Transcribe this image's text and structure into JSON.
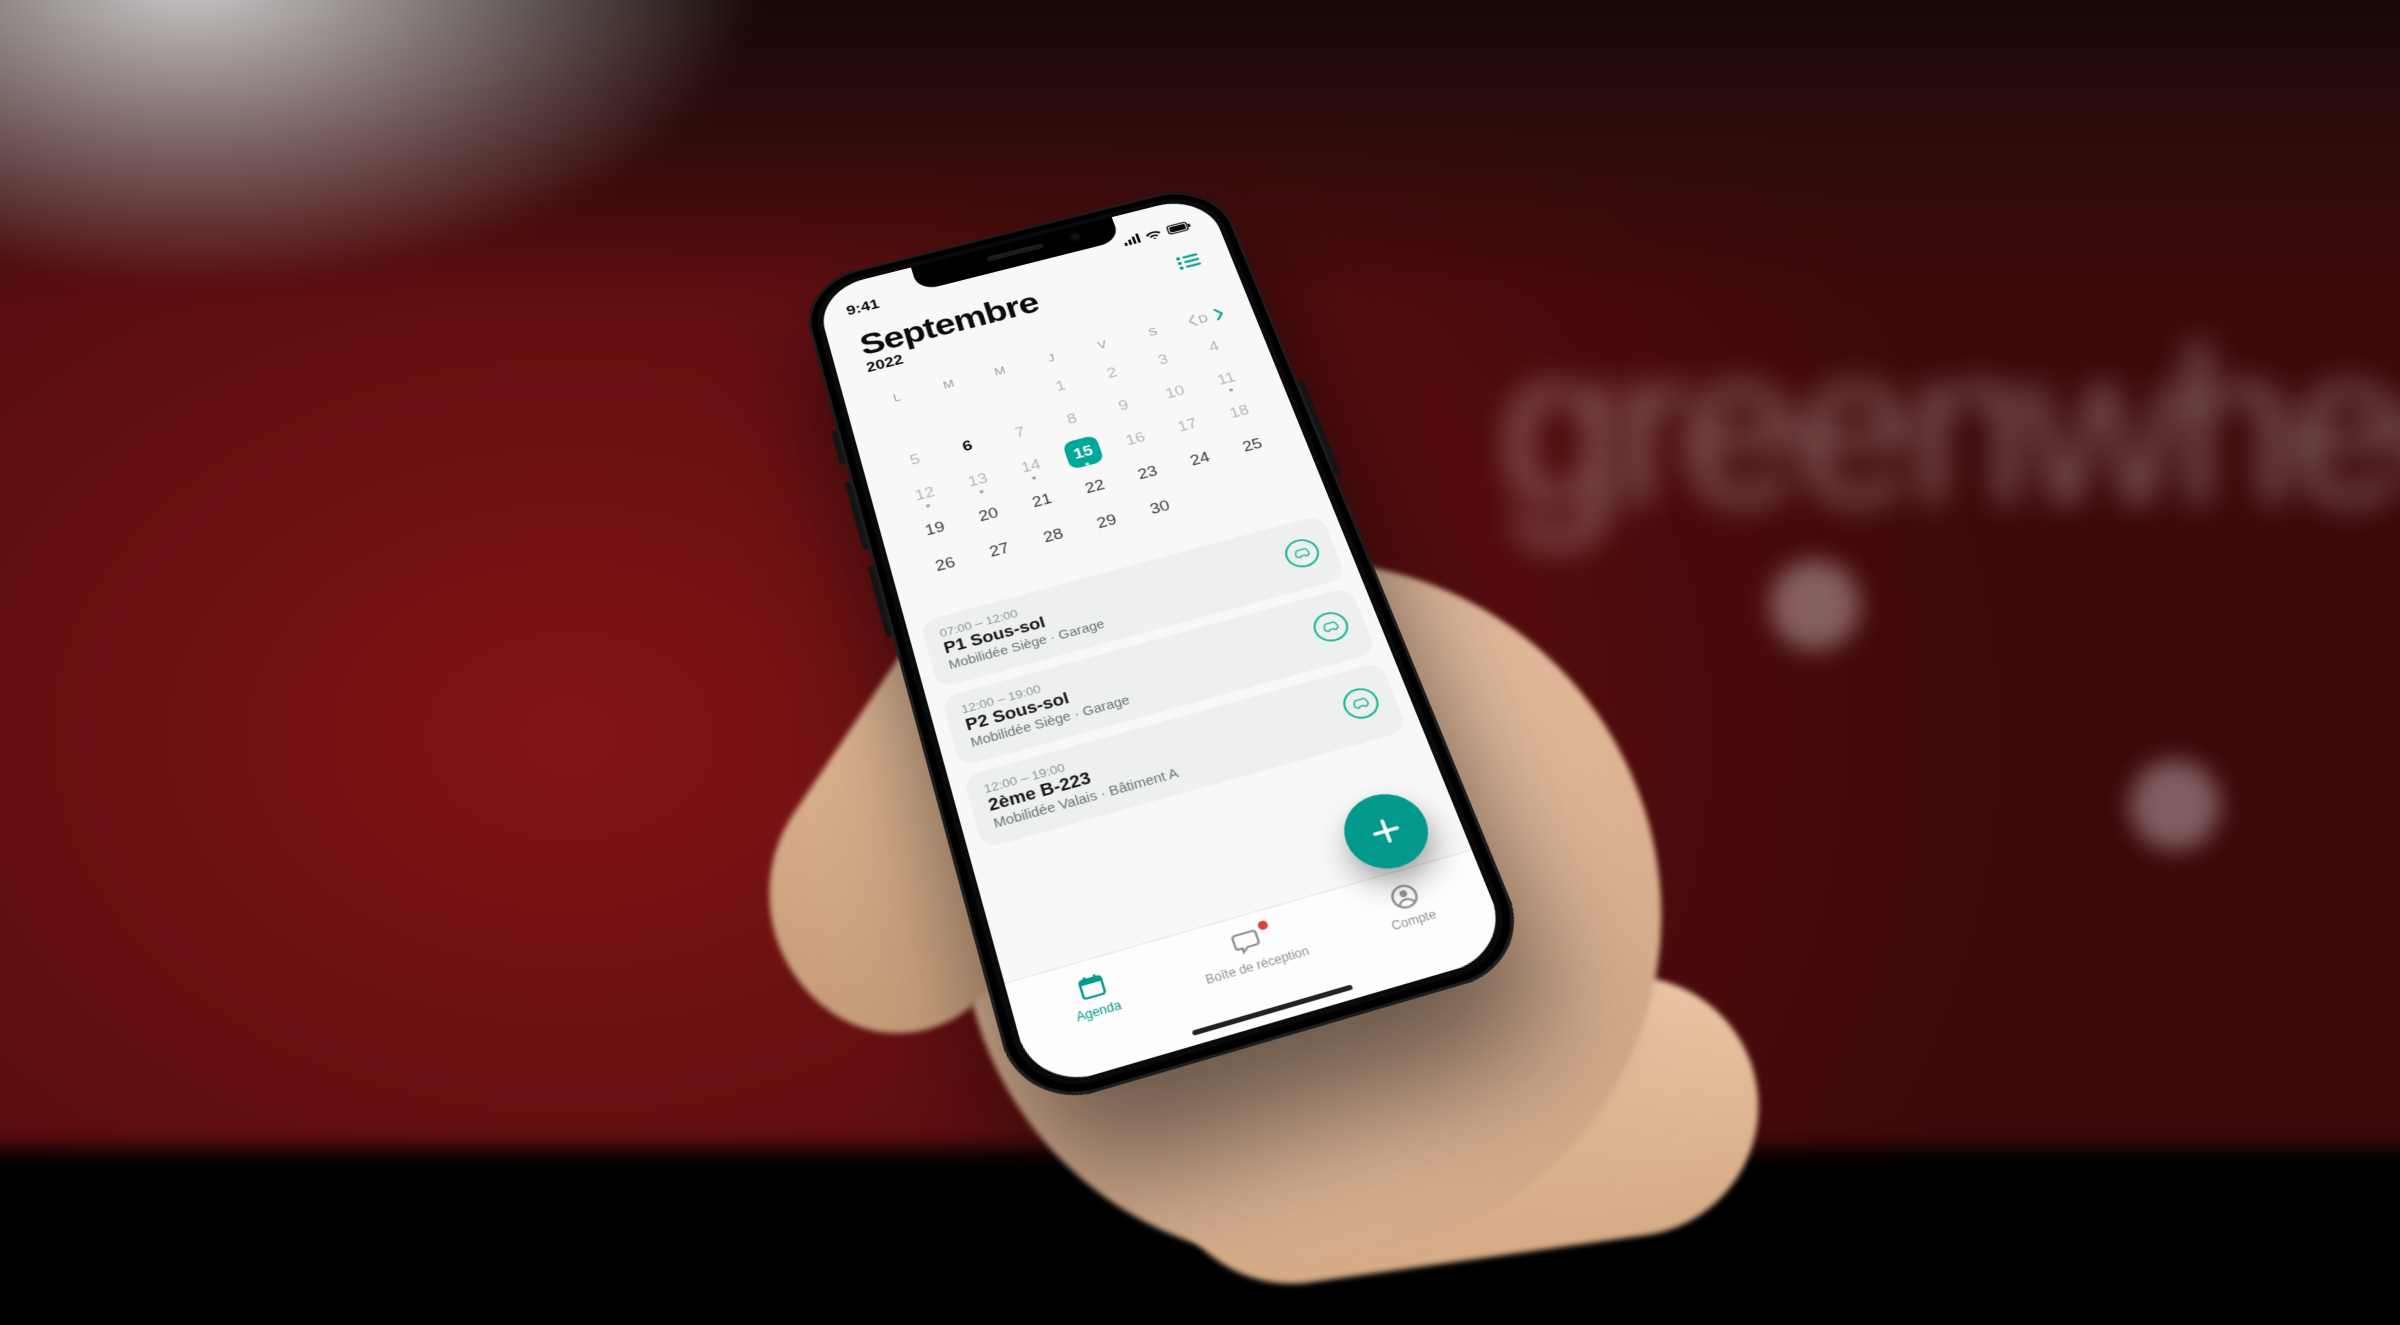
{
  "status": {
    "time": "9:41"
  },
  "header": {
    "month": "Septembre",
    "year": "2022"
  },
  "dow": [
    "L",
    "M",
    "M",
    "J",
    "V",
    "S",
    "D"
  ],
  "calendar": {
    "selected_day": 15,
    "weeks": [
      [
        {
          "n": ""
        },
        {
          "n": ""
        },
        {
          "n": ""
        },
        {
          "n": "1",
          "dim": true
        },
        {
          "n": "2",
          "dim": true
        },
        {
          "n": "3",
          "dim": true
        },
        {
          "n": "4",
          "dim": true
        }
      ],
      [
        {
          "n": "5",
          "dim": true
        },
        {
          "n": "6",
          "bold": true
        },
        {
          "n": "7",
          "dim": true
        },
        {
          "n": "8",
          "dim": true
        },
        {
          "n": "9",
          "dim": true
        },
        {
          "n": "10",
          "dim": true
        },
        {
          "n": "11",
          "dim": true,
          "dot": true
        }
      ],
      [
        {
          "n": "12",
          "dim": true,
          "dot": true
        },
        {
          "n": "13",
          "dim": true,
          "dot": true
        },
        {
          "n": "14",
          "dim": true,
          "dot": true
        },
        {
          "n": "15",
          "selected": true,
          "dot": true
        },
        {
          "n": "16",
          "dim": true
        },
        {
          "n": "17",
          "dim": true
        },
        {
          "n": "18",
          "dim": true
        }
      ],
      [
        {
          "n": "19"
        },
        {
          "n": "20"
        },
        {
          "n": "21"
        },
        {
          "n": "22"
        },
        {
          "n": "23"
        },
        {
          "n": "24"
        },
        {
          "n": "25"
        }
      ],
      [
        {
          "n": "26"
        },
        {
          "n": "27"
        },
        {
          "n": "28"
        },
        {
          "n": "29"
        },
        {
          "n": "30"
        },
        {
          "n": ""
        },
        {
          "n": ""
        }
      ]
    ]
  },
  "events": [
    {
      "time": "07:00 – 12:00",
      "title": "P1 Sous-sol",
      "sub": "Mobilidée Siège · Garage"
    },
    {
      "time": "12:00 – 19:00",
      "title": "P2 Sous-sol",
      "sub": "Mobilidée Siège · Garage"
    },
    {
      "time": "12:00 – 19:00",
      "title": "2ème B-223",
      "sub": "Mobilidée Valais · Bâtiment A"
    }
  ],
  "tabs": {
    "agenda": "Agenda",
    "inbox": "Boîte de réception",
    "account": "Compte"
  },
  "colors": {
    "accent": "#00998b"
  }
}
